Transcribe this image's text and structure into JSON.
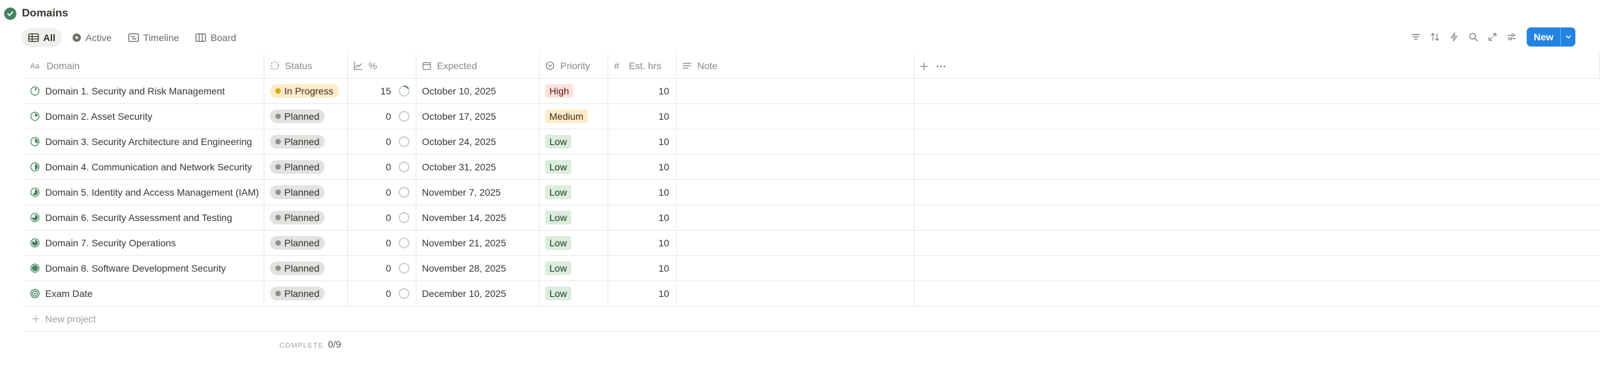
{
  "page": {
    "title": "Domains"
  },
  "views": [
    {
      "label": "All",
      "icon": "table-icon",
      "active": true
    },
    {
      "label": "Active",
      "icon": "sparkle-icon",
      "active": false
    },
    {
      "label": "Timeline",
      "icon": "timeline-icon",
      "active": false
    },
    {
      "label": "Board",
      "icon": "board-icon",
      "active": false
    }
  ],
  "toolbar": {
    "new_label": "New",
    "accent": "#2383e2"
  },
  "columns": {
    "domain": "Domain",
    "status": "Status",
    "pct": "%",
    "expected": "Expected",
    "priority": "Priority",
    "est": "Est. hrs",
    "note": "Note"
  },
  "rows": [
    {
      "domain": "Domain 1. Security and Risk Management",
      "status": "In Progress",
      "pct": "15",
      "progress": 0.15,
      "expected": "October 10, 2025",
      "priority": "High",
      "est": "10",
      "note": ""
    },
    {
      "domain": "Domain 2. Asset Security",
      "status": "Planned",
      "pct": "0",
      "progress": 0,
      "expected": "October 17, 2025",
      "priority": "Medium",
      "est": "10",
      "note": ""
    },
    {
      "domain": "Domain 3. Security Architecture and Engineering",
      "status": "Planned",
      "pct": "0",
      "progress": 0,
      "expected": "October 24, 2025",
      "priority": "Low",
      "est": "10",
      "note": ""
    },
    {
      "domain": "Domain 4. Communication and Network Security",
      "status": "Planned",
      "pct": "0",
      "progress": 0,
      "expected": "October 31, 2025",
      "priority": "Low",
      "est": "10",
      "note": ""
    },
    {
      "domain": "Domain 5. Identity and Access Management (IAM)",
      "status": "Planned",
      "pct": "0",
      "progress": 0,
      "expected": "November 7, 2025",
      "priority": "Low",
      "est": "10",
      "note": ""
    },
    {
      "domain": "Domain 6. Security Assessment and Testing",
      "status": "Planned",
      "pct": "0",
      "progress": 0,
      "expected": "November 14, 2025",
      "priority": "Low",
      "est": "10",
      "note": ""
    },
    {
      "domain": "Domain 7. Security Operations",
      "status": "Planned",
      "pct": "0",
      "progress": 0,
      "expected": "November 21, 2025",
      "priority": "Low",
      "est": "10",
      "note": ""
    },
    {
      "domain": "Domain 8. Software Development Security",
      "status": "Planned",
      "pct": "0",
      "progress": 0,
      "expected": "November 28, 2025",
      "priority": "Low",
      "est": "10",
      "note": ""
    },
    {
      "domain": "Exam Date",
      "status": "Planned",
      "pct": "0",
      "progress": 0,
      "expected": "December 10, 2025",
      "priority": "Low",
      "est": "10",
      "note": ""
    }
  ],
  "row_icon_fill": [
    0.125,
    0.25,
    0.375,
    0.5,
    0.625,
    0.75,
    0.875,
    1.0,
    "target"
  ],
  "new_row_label": "New project",
  "footer": {
    "complete_label": "COMPLETE",
    "complete_value": "0/9"
  },
  "colors": {
    "green": "#448361",
    "status": {
      "In Progress": {
        "bg": "#fdecc8",
        "dot": "#dfab01",
        "fg": "#402c1b"
      },
      "Planned": {
        "bg": "#e3e2e0",
        "dot": "#91918e",
        "fg": "#32302c"
      }
    },
    "priority": {
      "High": {
        "bg": "#ffe2dd",
        "fg": "#5d1715"
      },
      "Medium": {
        "bg": "#fdecc8",
        "fg": "#402c1b"
      },
      "Low": {
        "bg": "#dbeddb",
        "fg": "#1c3829"
      }
    }
  }
}
